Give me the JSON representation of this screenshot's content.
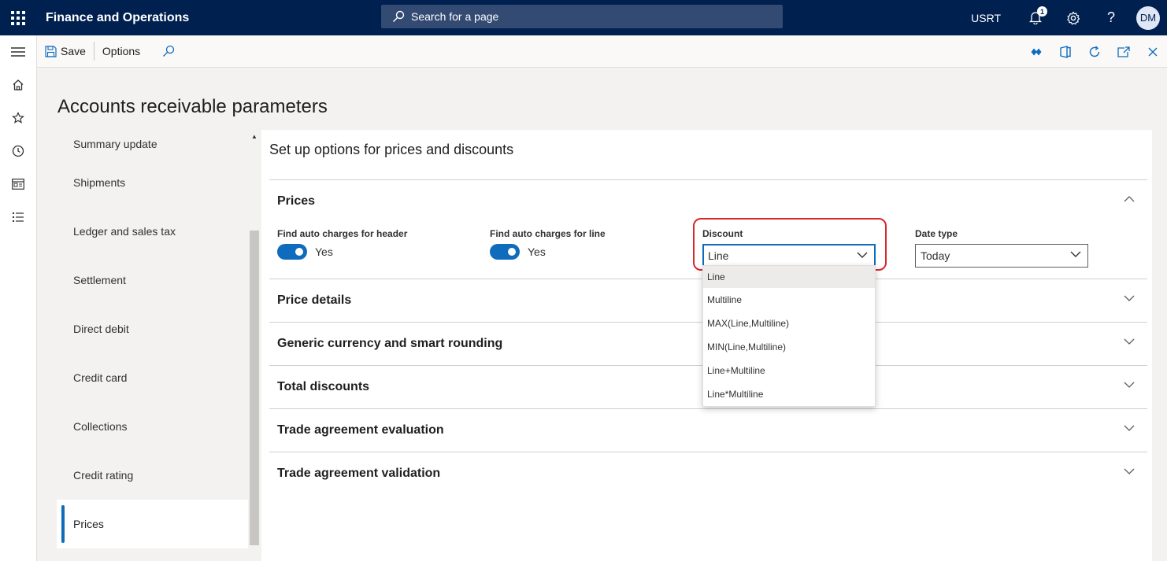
{
  "topbar": {
    "app_title": "Finance and Operations",
    "search_placeholder": "Search for a page",
    "company": "USRT",
    "notification_count": "1",
    "avatar_initials": "DM"
  },
  "actionpane": {
    "save_label": "Save",
    "options_label": "Options"
  },
  "page": {
    "title": "Accounts receivable parameters"
  },
  "tabs": [
    {
      "label": "Summary update",
      "selected": false
    },
    {
      "label": "Shipments",
      "selected": false
    },
    {
      "label": "Ledger and sales tax",
      "selected": false
    },
    {
      "label": "Settlement",
      "selected": false
    },
    {
      "label": "Direct debit",
      "selected": false
    },
    {
      "label": "Credit card",
      "selected": false
    },
    {
      "label": "Collections",
      "selected": false
    },
    {
      "label": "Credit rating",
      "selected": false
    },
    {
      "label": "Prices",
      "selected": true
    }
  ],
  "main": {
    "heading": "Set up options for prices and discounts",
    "fasttabs": [
      {
        "title": "Prices",
        "expanded": true
      },
      {
        "title": "Price details",
        "expanded": false
      },
      {
        "title": "Generic currency and smart rounding",
        "expanded": false
      },
      {
        "title": "Total discounts",
        "expanded": false
      },
      {
        "title": "Trade agreement evaluation",
        "expanded": false
      },
      {
        "title": "Trade agreement validation",
        "expanded": false
      }
    ],
    "prices": {
      "auto_header": {
        "label": "Find auto charges for header",
        "value": "Yes"
      },
      "auto_line": {
        "label": "Find auto charges for line",
        "value": "Yes"
      },
      "discount": {
        "label": "Discount",
        "value": "Line"
      },
      "date_type": {
        "label": "Date type",
        "value": "Today"
      }
    },
    "discount_options": [
      "Line",
      "Multiline",
      "MAX(Line,Multiline)",
      "MIN(Line,Multiline)",
      "Line+Multiline",
      "Line*Multiline"
    ]
  },
  "colors": {
    "topbar": "#002050",
    "accent": "#0f6cbd",
    "highlight": "#d9262b"
  }
}
